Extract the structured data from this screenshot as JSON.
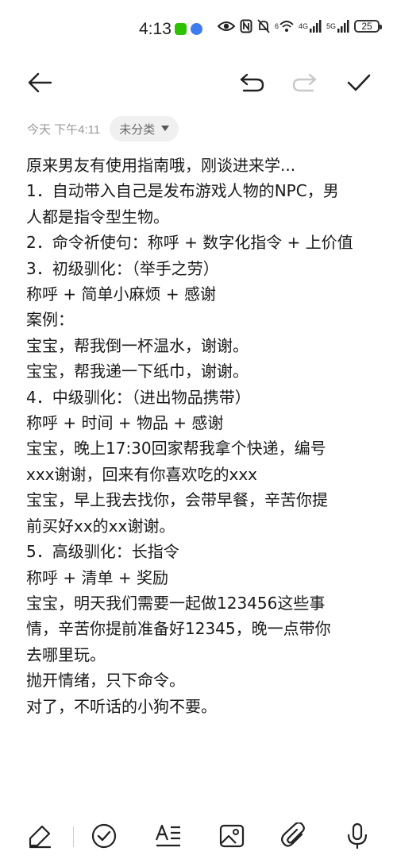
{
  "status_bar": {
    "time": "4:13",
    "battery": "25",
    "signal_1_label": "4G",
    "signal_2_label": "5G",
    "wifi_label": "6"
  },
  "meta": {
    "date": "今天 下午4:11",
    "category": "未分类"
  },
  "note": {
    "lines": [
      "原来男友有使用指南哦，刚谈进来学...",
      "1．自动带入自己是发布游戏人物的NPC，男",
      "人都是指令型生物。",
      "2．命令祈使句：称呼 + 数字化指令 + 上价值",
      "3．初级驯化：（举手之劳）",
      "称呼 + 简单小麻烦 + 感谢",
      "案例：",
      "宝宝，帮我倒一杯温水，谢谢。",
      "宝宝，帮我递一下纸巾，谢谢。",
      "4．中级驯化：（进出物品携带）",
      "称呼 + 时间 + 物品 + 感谢",
      "宝宝，晚上17:30回家帮我拿个快递，编号",
      "xxx谢谢，回来有你喜欢吃的xxx",
      "宝宝，早上我去找你，会带早餐，辛苦你提",
      "前买好xx的xx谢谢。",
      "5．高级驯化：长指令",
      "称呼 + 清单 + 奖励",
      "宝宝，明天我们需要一起做123456这些事",
      "情，辛苦你提前准备好12345，晚一点带你",
      "去哪里玩。",
      "抛开情绪，只下命令。",
      "对了，不听话的小狗不要。"
    ]
  },
  "icons": {
    "back": "back-arrow-icon",
    "undo": "undo-icon",
    "redo": "redo-icon",
    "done": "checkmark-icon",
    "pen": "pen-icon",
    "checklist": "checklist-icon",
    "text_format": "text-format-icon",
    "image": "image-icon",
    "attach": "attachment-icon",
    "mic": "microphone-icon"
  },
  "colors": {
    "text": "#1a1a1a",
    "meta": "#9a9a9a",
    "chip_bg": "#f0f0f0",
    "disabled": "#c8c8c8",
    "wechat": "#2dc100",
    "music": "#3d7cf0"
  }
}
